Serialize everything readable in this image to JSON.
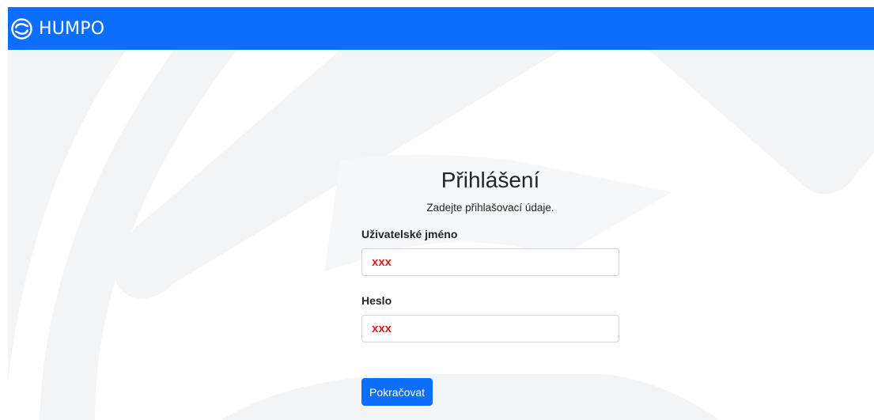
{
  "navbar": {
    "brand_name": "HUMPO",
    "brand_icon": "humpo-logo-icon",
    "background_color": "#0d6efd"
  },
  "login": {
    "title": "Přihlášení",
    "subtitle": "Zadejte přihlašovací údaje.",
    "username_label": "Uživatelské jméno",
    "username_value": "xxx",
    "password_label": "Heslo",
    "password_value": "xxx",
    "submit_label": "Pokračovat"
  },
  "colors": {
    "accent": "#0d6efd",
    "input_text": "#e02020",
    "background_art": "#f3f4f6"
  }
}
